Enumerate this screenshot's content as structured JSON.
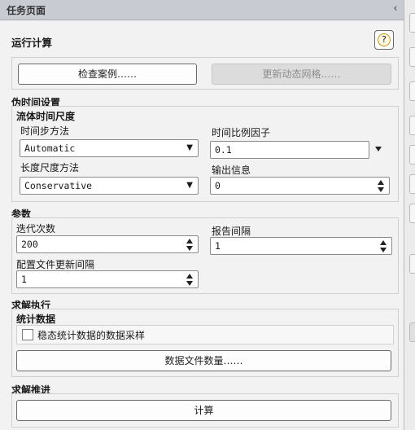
{
  "panel": {
    "title": "任务页面",
    "collapse_icon": "chevron-left-icon"
  },
  "run": {
    "title": "运行计算",
    "help_label": "?",
    "check_case_btn": "检查案例……",
    "update_mesh_btn": "更新动态网格……"
  },
  "pseudo": {
    "title": "伪时间设置",
    "sub": "流体时间尺度",
    "timestep_method_label": "时间步方法",
    "timestep_method_value": "Automatic",
    "time_scale_factor_label": "时间比例因子",
    "time_scale_factor_value": "0.1",
    "length_scale_method_label": "长度尺度方法",
    "length_scale_method_value": "Conservative",
    "output_info_label": "输出信息",
    "output_info_value": "0"
  },
  "params": {
    "title": "参数",
    "iterations_label": "迭代次数",
    "iterations_value": "200",
    "report_interval_label": "报告间隔",
    "report_interval_value": "1",
    "profile_update_label": "配置文件更新间隔",
    "profile_update_value": "1"
  },
  "solve": {
    "title": "求解执行",
    "stats_title": "统计数据",
    "steady_sampling_label": "稳态统计数据的数据采样",
    "steady_sampling_checked": false,
    "data_file_count_btn": "数据文件数量……"
  },
  "advance": {
    "title": "求解推进",
    "calculate_btn": "计算"
  }
}
